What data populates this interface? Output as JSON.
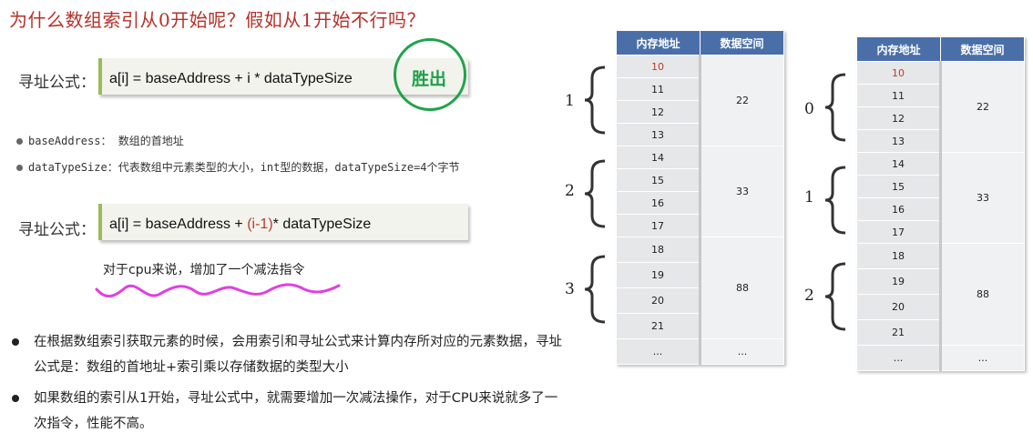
{
  "title": "为什么数组索引从0开始呢？假如从1开始不行吗？",
  "formula1": {
    "label": "寻址公式：",
    "text": "a[i] = baseAddress + i * dataTypeSize",
    "badge": "胜出"
  },
  "bullets_small": [
    "baseAddress： 数组的首地址",
    "dataTypeSize：代表数组中元素类型的大小，int型的数据，dataTypeSize=4个字节"
  ],
  "formula2": {
    "label": "寻址公式：",
    "prefix": "a[i] = baseAddress + ",
    "highlight": "(i-1)",
    "suffix": "* dataTypeSize"
  },
  "note": "对于cpu来说，增加了一个减法指令",
  "paragraphs": [
    "在根据数组索引获取元素的时候，会用索引和寻址公式来计算内存所对应的元素数据，寻址公式是：数组的首地址+索引乘以存储数据的类型大小",
    "如果数组的索引从1开始，寻址公式中，就需要增加一次减法操作，对于CPU来说就多了一次指令，性能不高。"
  ],
  "table_left": {
    "headers": [
      "内存地址",
      "数据空间"
    ],
    "addresses": [
      "10",
      "11",
      "12",
      "13",
      "14",
      "15",
      "16",
      "17",
      "18",
      "19",
      "20",
      "21",
      "..."
    ],
    "values": [
      "22",
      "33",
      "88",
      "..."
    ],
    "indices": [
      "1",
      "2",
      "3"
    ]
  },
  "table_right": {
    "headers": [
      "内存地址",
      "数据空间"
    ],
    "addresses": [
      "10",
      "11",
      "12",
      "13",
      "14",
      "15",
      "16",
      "17",
      "18",
      "19",
      "20",
      "21",
      "..."
    ],
    "values": [
      "22",
      "33",
      "88",
      "..."
    ],
    "indices": [
      "0",
      "1",
      "2"
    ]
  },
  "colors": {
    "title": "#b5312a",
    "header": "#4a6fa8",
    "win": "#1fa34a",
    "squiggle": "#e040e0"
  }
}
